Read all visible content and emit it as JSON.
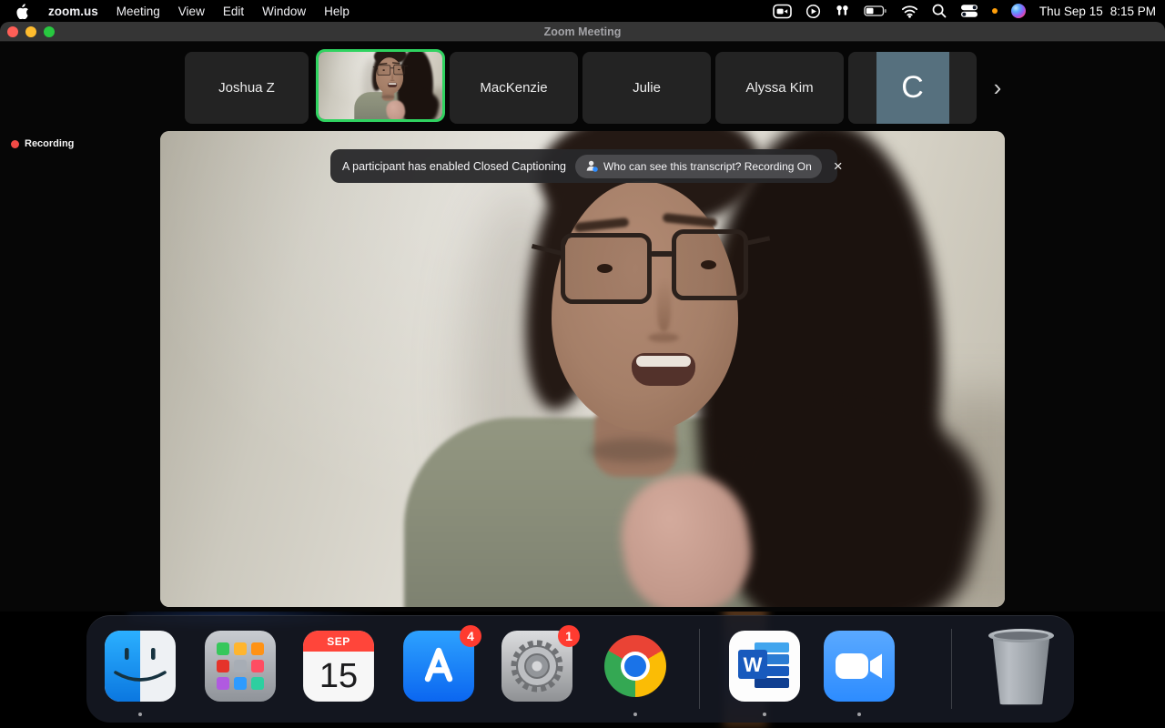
{
  "menu_bar": {
    "app_name": "zoom.us",
    "menus": [
      "Meeting",
      "View",
      "Edit",
      "Window",
      "Help"
    ],
    "status_icons": [
      "screen-recording-camera",
      "now-playing",
      "airpods",
      "battery",
      "wifi",
      "spotlight-search",
      "control-center",
      "notification-dot",
      "siri"
    ],
    "clock": {
      "date": "Thu Sep 15",
      "time": "8:15 PM"
    }
  },
  "window": {
    "title": "Zoom Meeting"
  },
  "filmstrip": {
    "participants": [
      {
        "label": "Joshua Z",
        "type": "name-tile"
      },
      {
        "label": "",
        "type": "active-video-tile"
      },
      {
        "label": "MacKenzie",
        "type": "name-tile"
      },
      {
        "label": "Julie",
        "type": "name-tile"
      },
      {
        "label": "Alyssa Kim",
        "type": "name-tile"
      },
      {
        "label": "C",
        "type": "avatar-tile"
      }
    ],
    "next_chevron": "›"
  },
  "recording_indicator": {
    "label": "Recording"
  },
  "banner": {
    "message": "A participant has enabled Closed Captioning",
    "transcript_button": "Who can see this transcript? Recording On",
    "close_glyph": "×"
  },
  "dock": {
    "items": [
      "finder",
      "launchpad",
      "calendar",
      "app-store",
      "system-preferences",
      "chrome",
      "word",
      "zoom",
      "trash"
    ],
    "calendar": {
      "month": "SEP",
      "day": "15"
    },
    "badges": {
      "app_store": "4",
      "system_preferences": "1"
    },
    "word_letter": "W"
  },
  "colors": {
    "active_speaker_green": "#2fd360",
    "recording_red": "#f04a45",
    "badge_red": "#ff3b30",
    "avatar_bg": "#56707e",
    "menubar_tint": "#1d2b49"
  }
}
